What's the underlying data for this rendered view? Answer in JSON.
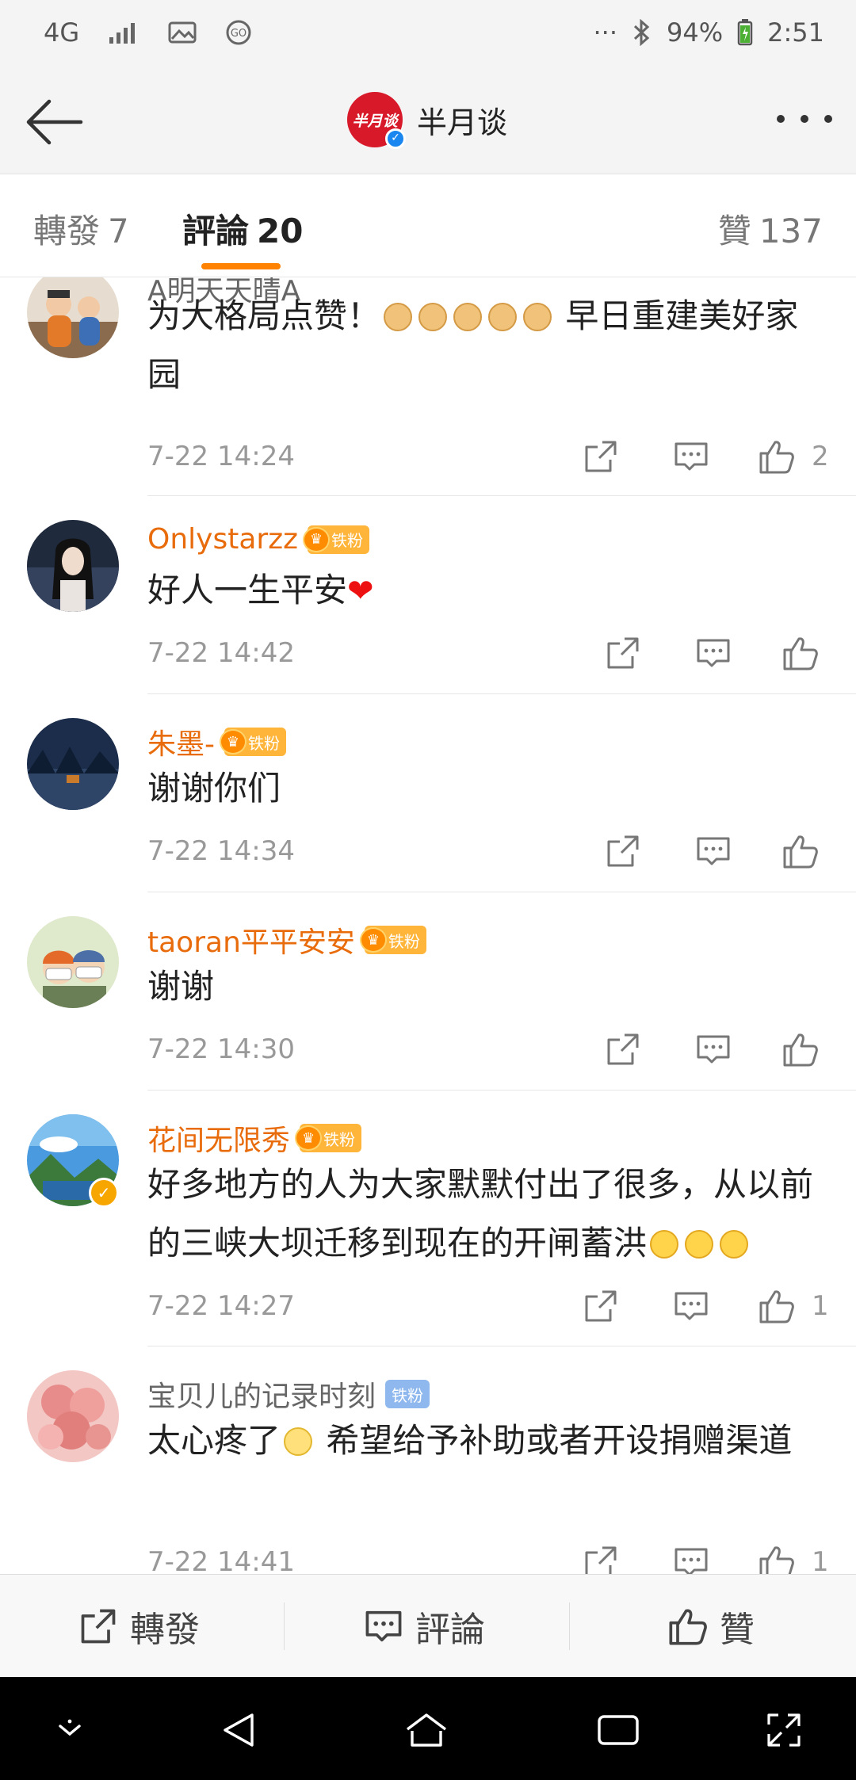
{
  "status_bar": {
    "network": "4G",
    "battery": "94%",
    "time": "2:51",
    "dots": "···"
  },
  "header": {
    "logo_text": "半月谈",
    "account_name": "半月谈"
  },
  "tabs": [
    {
      "label": "轉發",
      "count": "7"
    },
    {
      "label": "評論",
      "count": "20"
    },
    {
      "label": "贊",
      "count": "137"
    }
  ],
  "comments": [
    {
      "username": "A明天天晴A",
      "text": "为大格局点赞！",
      "text_suffix": "早日重建美好家园",
      "time": "7-22 14:24",
      "likes": "2"
    },
    {
      "username": "Onlystarzz",
      "badge": "铁粉",
      "text": "好人一生平安",
      "time": "7-22 14:42",
      "likes": ""
    },
    {
      "username": "朱墨-",
      "badge": "铁粉",
      "text": "谢谢你们",
      "time": "7-22 14:34",
      "likes": ""
    },
    {
      "username": "taoran平平安安",
      "badge": "铁粉",
      "text": "谢谢",
      "time": "7-22 14:30",
      "likes": ""
    },
    {
      "username": "花间无限秀",
      "badge": "铁粉",
      "text": "好多地方的人为大家默默付出了很多，从以前的三峡大坝迁移到现在的开闸蓄洪",
      "time": "7-22 14:27",
      "likes": "1"
    },
    {
      "username": "宝贝儿的记录时刻",
      "badge": "铁粉",
      "text": "太心疼了",
      "text_suffix": "希望给予补助或者开设捐赠渠道",
      "time": "7-22 14:41",
      "likes": "1"
    }
  ],
  "bottom_bar": {
    "repost": "轉發",
    "comment": "評論",
    "like": "贊"
  },
  "colors": {
    "accent": "#ff8200",
    "username_orange": "#e86b0c",
    "badge_gold": "#ffb43a"
  }
}
